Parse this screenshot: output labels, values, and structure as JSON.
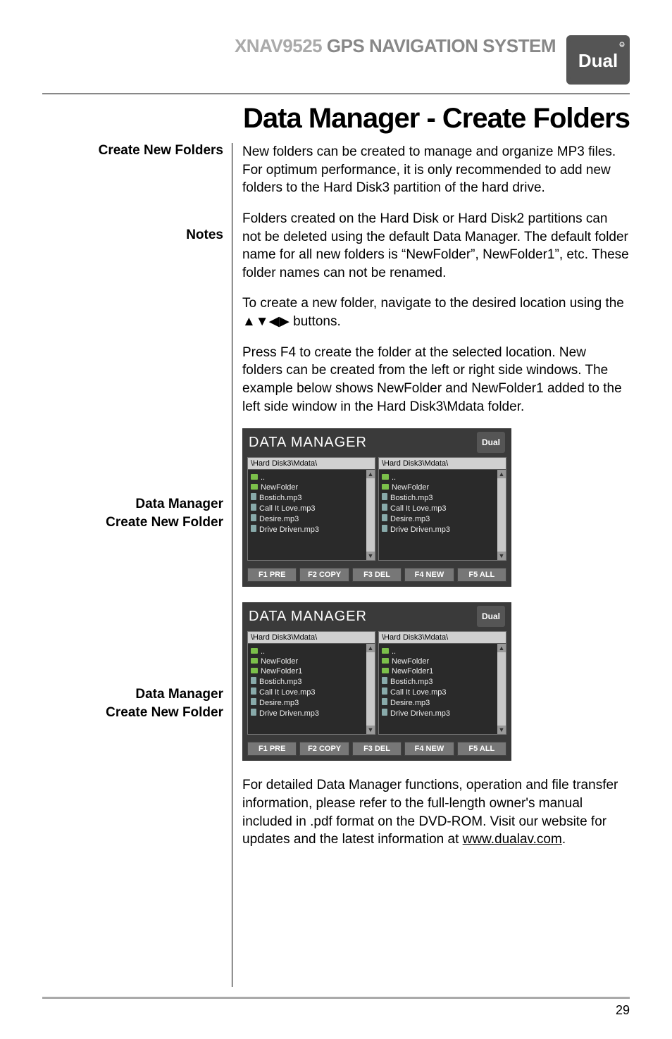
{
  "product": {
    "model": "XNAV9525",
    "system": "GPS NAVIGATION SYSTEM",
    "brand_alt": "Dual"
  },
  "page_title": "Data Manager - Create Folders",
  "labels": {
    "create_new_folders": "Create New Folders",
    "notes": "Notes",
    "dm_create_1": "Data Manager",
    "dm_create_1b": "Create New Folder",
    "dm_create_2": "Data Manager",
    "dm_create_2b": "Create New Folder"
  },
  "body": {
    "p1": "New folders can be created to manage and organize MP3 files. For optimum performance, it is only recommended to add new folders to the Hard Disk3 partition of the hard drive.",
    "p2": "Folders created on the Hard Disk or Hard Disk2 partitions can not be deleted using the default Data Manager. The default folder name for all new folders is “NewFolder”, NewFolder1”, etc. These folder names can not be renamed.",
    "p3a": "To create a new folder, navigate to the desired location using the ",
    "p3b": " buttons.",
    "arrows": "▲▼◀▶",
    "p4": "Press F4 to create the folder at the selected location. New folders can be created from the left or right side windows. The example below shows NewFolder and NewFolder1 added to the left side window in the Hard Disk3\\Mdata folder.",
    "footnote_a": "For detailed Data Manager functions, operation and file transfer information, please refer to the full-length owner's manual included in .pdf format on the DVD-ROM. Visit our website for updates and the latest information at ",
    "footnote_link": "www.dualav.com",
    "footnote_b": "."
  },
  "screenshots": {
    "title": "DATA MANAGER",
    "mini_brand": "Dual",
    "path": "\\Hard Disk3\\Mdata\\",
    "fn": {
      "f1": "F1 PRE",
      "f2": "F2 COPY",
      "f3": "F3 DEL",
      "f4": "F4 NEW",
      "f5": "F5 ALL"
    },
    "s1": {
      "left_items": [
        {
          "t": "folder",
          "n": ".."
        },
        {
          "t": "folder",
          "n": "NewFolder"
        },
        {
          "t": "mp3",
          "n": "Bostich.mp3"
        },
        {
          "t": "mp3",
          "n": "Call It Love.mp3"
        },
        {
          "t": "mp3",
          "n": "Desire.mp3"
        },
        {
          "t": "mp3",
          "n": "Drive Driven.mp3"
        }
      ],
      "right_items": [
        {
          "t": "folder",
          "n": ".."
        },
        {
          "t": "folder",
          "n": "NewFolder"
        },
        {
          "t": "mp3",
          "n": "Bostich.mp3"
        },
        {
          "t": "mp3",
          "n": "Call It Love.mp3"
        },
        {
          "t": "mp3",
          "n": "Desire.mp3"
        },
        {
          "t": "mp3",
          "n": "Drive Driven.mp3"
        }
      ]
    },
    "s2": {
      "left_items": [
        {
          "t": "folder",
          "n": ".."
        },
        {
          "t": "folder",
          "n": "NewFolder"
        },
        {
          "t": "folder",
          "n": "NewFolder1"
        },
        {
          "t": "mp3",
          "n": "Bostich.mp3"
        },
        {
          "t": "mp3",
          "n": "Call It Love.mp3"
        },
        {
          "t": "mp3",
          "n": "Desire.mp3"
        },
        {
          "t": "mp3",
          "n": "Drive Driven.mp3"
        }
      ],
      "right_items": [
        {
          "t": "folder",
          "n": ".."
        },
        {
          "t": "folder",
          "n": "NewFolder"
        },
        {
          "t": "folder",
          "n": "NewFolder1"
        },
        {
          "t": "mp3",
          "n": "Bostich.mp3"
        },
        {
          "t": "mp3",
          "n": "Call It Love.mp3"
        },
        {
          "t": "mp3",
          "n": "Desire.mp3"
        },
        {
          "t": "mp3",
          "n": "Drive Driven.mp3"
        }
      ]
    }
  },
  "page_number": "29"
}
